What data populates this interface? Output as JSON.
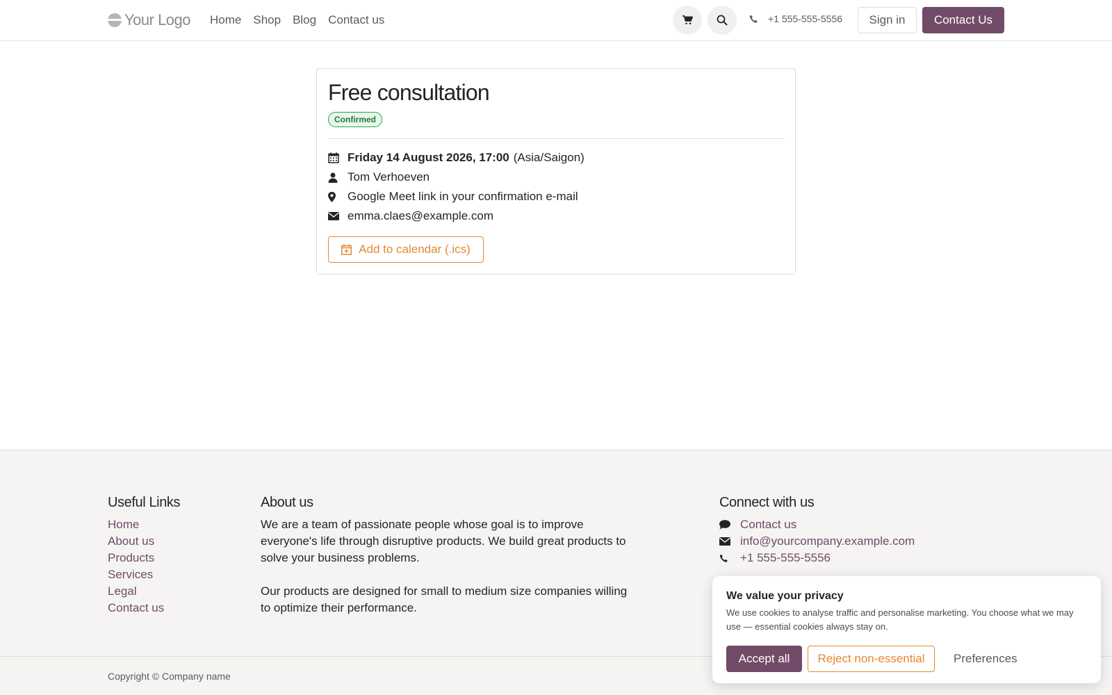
{
  "header": {
    "logo_text": "Your Logo",
    "nav": [
      "Home",
      "Shop",
      "Blog",
      "Contact us"
    ],
    "phone": "+1 555-555-5556",
    "sign_in": "Sign in",
    "contact_cta": "Contact Us"
  },
  "appointment": {
    "title": "Free consultation",
    "status": "Confirmed",
    "date": "Friday 14 August 2026, 17:00",
    "timezone": "(Asia/Saigon)",
    "person": "Tom Verhoeven",
    "location": "Google Meet link in your confirmation e-mail",
    "email": "emma.claes@example.com",
    "calendar_button": "Add to calendar (.ics)"
  },
  "footer": {
    "useful_links_title": "Useful Links",
    "useful_links": [
      "Home",
      "About us",
      "Products",
      "Services",
      "Legal",
      "Contact us"
    ],
    "about_title": "About us",
    "about_p1": "We are a team of passionate people whose goal is to improve everyone's life through disruptive products. We build great products to solve your business problems.",
    "about_p2": "Our products are designed for small to medium size companies willing to optimize their performance.",
    "connect_title": "Connect with us",
    "connect_contact": "Contact us",
    "connect_email": "info@yourcompany.example.com",
    "connect_phone": "+1 555-555-5556",
    "copyright": "Copyright © Company name"
  },
  "cookie": {
    "title": "We value your privacy",
    "text": "We use cookies to analyse traffic and personalise marketing. You choose what we may use — essential cookies always stay on.",
    "accept": "Accept all",
    "reject": "Reject non-essential",
    "preferences": "Preferences"
  },
  "colors": {
    "brand": "#714b67",
    "accent": "#e28a32",
    "success": "#28a745"
  }
}
